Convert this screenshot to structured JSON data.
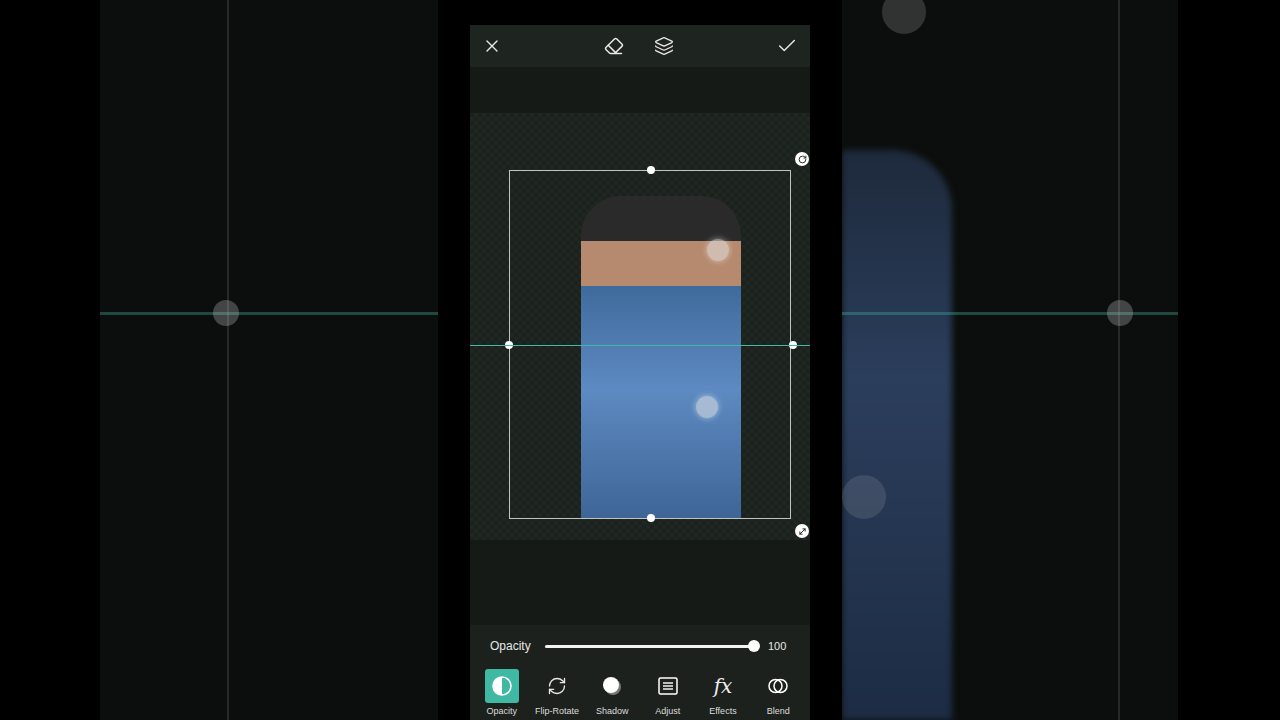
{
  "editor": {
    "guide_visible": true,
    "selection_active": true
  },
  "opacity_control": {
    "label": "Opacity",
    "level": 1.0,
    "reading": "100"
  },
  "tools": [
    {
      "label": "Opacity",
      "selected": true,
      "kind": "opacity"
    },
    {
      "label": "Flip-Rotate",
      "selected": false,
      "kind": "flip"
    },
    {
      "label": "Shadow",
      "selected": false,
      "kind": "shadow"
    },
    {
      "label": "Adjust",
      "selected": false,
      "kind": "adjust"
    },
    {
      "label": "Effects",
      "selected": false,
      "kind": "effects",
      "glyph": "fx"
    },
    {
      "label": "Blend",
      "selected": false,
      "kind": "blend"
    }
  ]
}
